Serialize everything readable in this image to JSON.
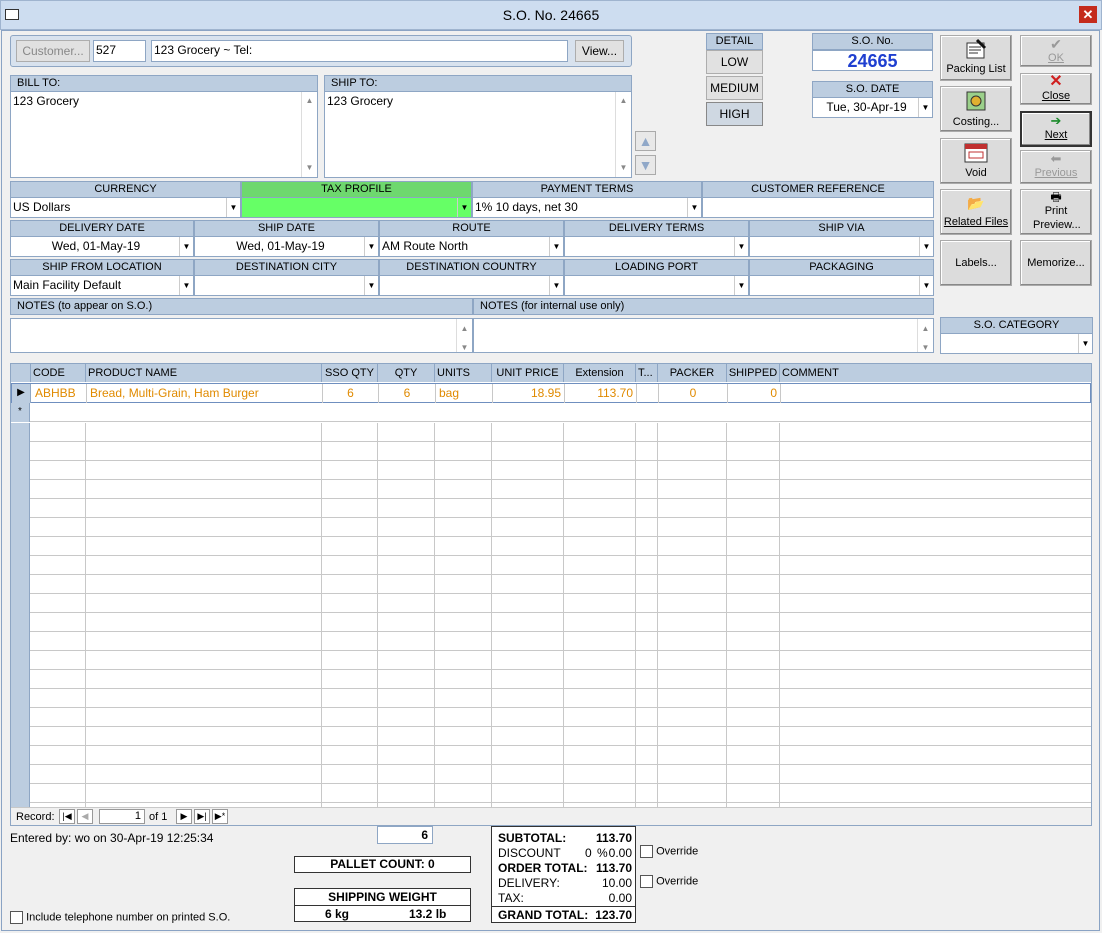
{
  "window": {
    "title": "S.O. No. 24665"
  },
  "customer": {
    "button": "Customer...",
    "id": "527",
    "name": "123 Grocery  ~  Tel:",
    "view_button": "View..."
  },
  "detail": {
    "header": "DETAIL",
    "low": "LOW",
    "medium": "MEDIUM",
    "high": "HIGH"
  },
  "so_no": {
    "label": "S.O. No.",
    "value": "24665"
  },
  "so_date": {
    "label": "S.O. DATE",
    "value": "Tue, 30-Apr-19"
  },
  "bill_to": {
    "label": "BILL TO:",
    "value": "123 Grocery"
  },
  "ship_to": {
    "label": "SHIP TO:",
    "value": "123 Grocery"
  },
  "buttons": {
    "packing_list": "Packing List",
    "ok": "OK",
    "costing": "Costing...",
    "close": "Close",
    "void": "Void",
    "next": "Next",
    "previous": "Previous",
    "related_files": "Related Files",
    "print_preview": "Print Preview...",
    "labels": "Labels...",
    "memorize": "Memorize..."
  },
  "fields": {
    "currency": {
      "label": "CURRENCY",
      "value": "US Dollars"
    },
    "tax_profile": {
      "label": "TAX PROFILE",
      "value": ""
    },
    "payment_terms": {
      "label": "PAYMENT TERMS",
      "value": "1% 10 days, net 30"
    },
    "customer_reference": {
      "label": "CUSTOMER REFERENCE",
      "value": ""
    },
    "delivery_date": {
      "label": "DELIVERY DATE",
      "value": "Wed, 01-May-19"
    },
    "ship_date": {
      "label": "SHIP DATE",
      "value": "Wed, 01-May-19"
    },
    "route": {
      "label": "ROUTE",
      "value": "AM Route North"
    },
    "delivery_terms": {
      "label": "DELIVERY TERMS",
      "value": ""
    },
    "ship_via": {
      "label": "SHIP VIA",
      "value": ""
    },
    "ship_from": {
      "label": "SHIP FROM LOCATION",
      "value": "Main Facility Default"
    },
    "dest_city": {
      "label": "DESTINATION CITY",
      "value": ""
    },
    "dest_country": {
      "label": "DESTINATION COUNTRY",
      "value": ""
    },
    "loading_port": {
      "label": "LOADING PORT",
      "value": ""
    },
    "packaging": {
      "label": "PACKAGING",
      "value": ""
    },
    "notes_so": {
      "label": "NOTES (to appear on S.O.)",
      "value": ""
    },
    "notes_internal": {
      "label": "NOTES (for internal use only)",
      "value": ""
    },
    "so_category": {
      "label": "S.O. CATEGORY",
      "value": ""
    }
  },
  "grid": {
    "columns": [
      "CODE",
      "PRODUCT NAME",
      "SSO QTY",
      "QTY",
      "UNITS",
      "UNIT PRICE",
      "Extension",
      "T...",
      "PACKER",
      "SHIPPED",
      "COMMENT"
    ],
    "rows": [
      {
        "code": "ABHBB",
        "name": "Bread, Multi-Grain, Ham Burger",
        "sso_qty": "6",
        "qty": "6",
        "units": "bag",
        "unit_price": "18.95",
        "extension": "113.70",
        "t": "",
        "packer": "0",
        "shipped": "0",
        "comment": ""
      }
    ],
    "new_row_marker": "*"
  },
  "record_nav": {
    "label": "Record:",
    "current": "1",
    "of": "of 1"
  },
  "footer": {
    "entered_by": "Entered by: wo on 30-Apr-19 12:25:34",
    "qty_total": "6",
    "pallet_count": "PALLET COUNT: 0",
    "shipping_weight_label": "SHIPPING WEIGHT",
    "weight_kg": "6 kg",
    "weight_lb": "13.2 lb",
    "include_tel": "Include telephone number on printed S.O."
  },
  "totals": {
    "subtotal_label": "SUBTOTAL:",
    "subtotal": "113.70",
    "discount_label": "DISCOUNT",
    "discount_pct": "0",
    "discount_sign": "%",
    "discount": "0.00",
    "order_total_label": "ORDER TOTAL:",
    "order_total": "113.70",
    "delivery_label": "DELIVERY:",
    "delivery": "10.00",
    "tax_label": "TAX:",
    "tax": "0.00",
    "grand_total_label": "GRAND TOTAL:",
    "grand_total": "123.70",
    "override1": "Override",
    "override2": "Override"
  },
  "colors": {
    "header_bg": "#bccde0",
    "tax_green": "#66ff66",
    "so_no_blue": "#1f3fd0",
    "orange": "#e08a00"
  }
}
